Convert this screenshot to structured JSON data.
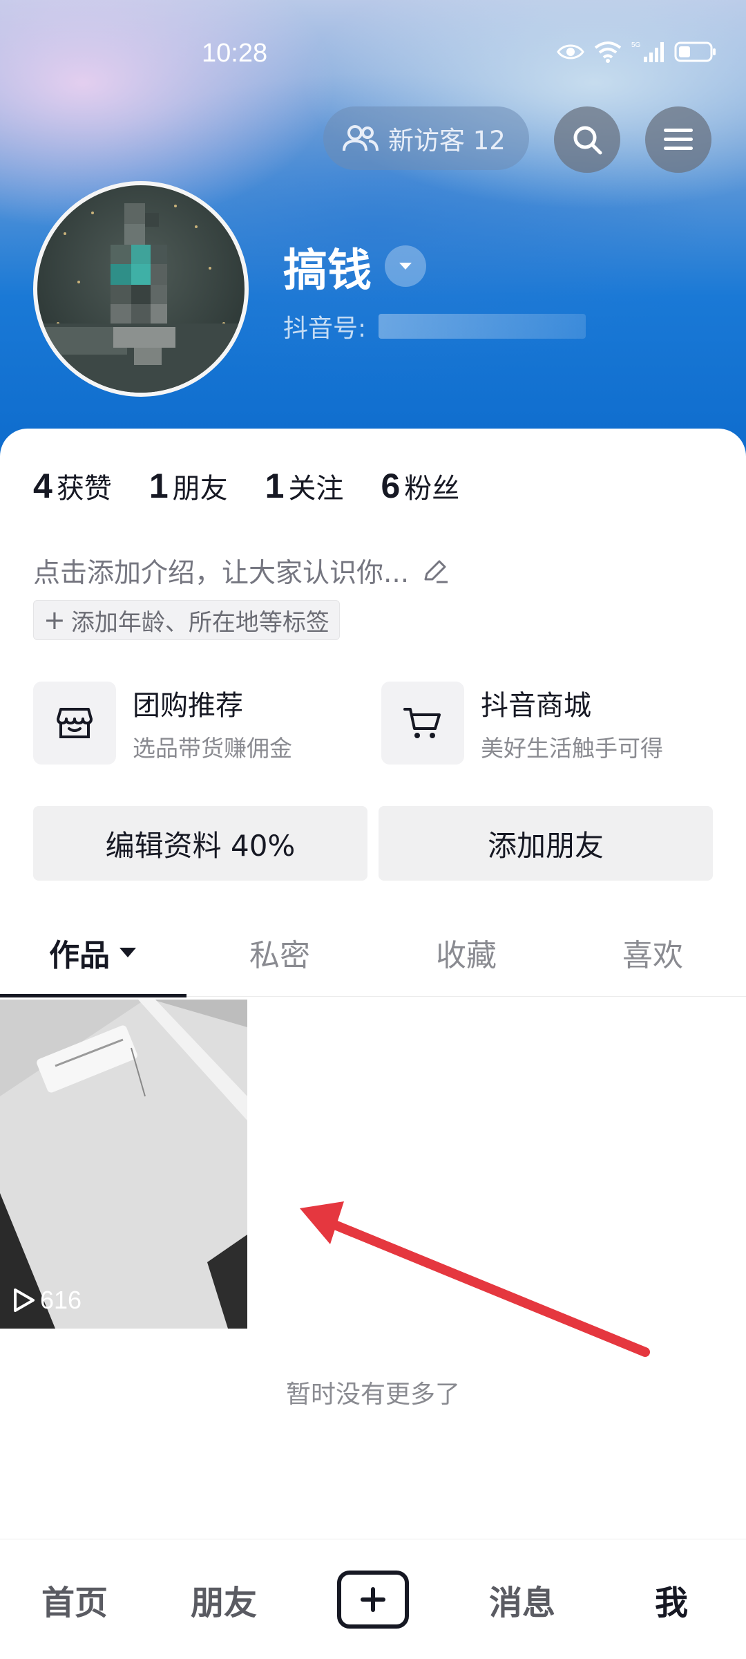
{
  "status_bar": {
    "time": "10:28"
  },
  "header": {
    "visitor_label": "新访客 12",
    "username": "搞钱",
    "douyin_id_label": "抖音号:"
  },
  "stats": [
    {
      "num": "4",
      "label": "获赞"
    },
    {
      "num": "1",
      "label": "朋友"
    },
    {
      "num": "1",
      "label": "关注"
    },
    {
      "num": "6",
      "label": "粉丝"
    }
  ],
  "profile": {
    "bio_placeholder": "点击添加介绍，让大家认识你...",
    "tag_add_label": "添加年龄、所在地等标签"
  },
  "services": [
    {
      "title": "团购推荐",
      "subtitle": "选品带货赚佣金",
      "icon": "group-buy-icon"
    },
    {
      "title": "抖音商城",
      "subtitle": "美好生活触手可得",
      "icon": "cart-icon"
    }
  ],
  "actions": {
    "edit_label": "编辑资料 40%",
    "add_friend_label": "添加朋友"
  },
  "tabs": [
    {
      "label": "作品",
      "active": true
    },
    {
      "label": "私密",
      "active": false
    },
    {
      "label": "收藏",
      "active": false
    },
    {
      "label": "喜欢",
      "active": false
    }
  ],
  "videos": [
    {
      "play_count": "616"
    }
  ],
  "feed": {
    "end_text": "暂时没有更多了"
  },
  "bottom_nav": [
    {
      "label": "首页",
      "active": false
    },
    {
      "label": "朋友",
      "active": false
    },
    {
      "label": "",
      "icon": "plus-icon"
    },
    {
      "label": "消息",
      "active": false
    },
    {
      "label": "我",
      "active": true
    }
  ],
  "colors": {
    "annotation_arrow": "#e5373f",
    "header_blue": "#0e6ccd",
    "text_primary": "#161823",
    "text_secondary": "#8a8b91"
  }
}
